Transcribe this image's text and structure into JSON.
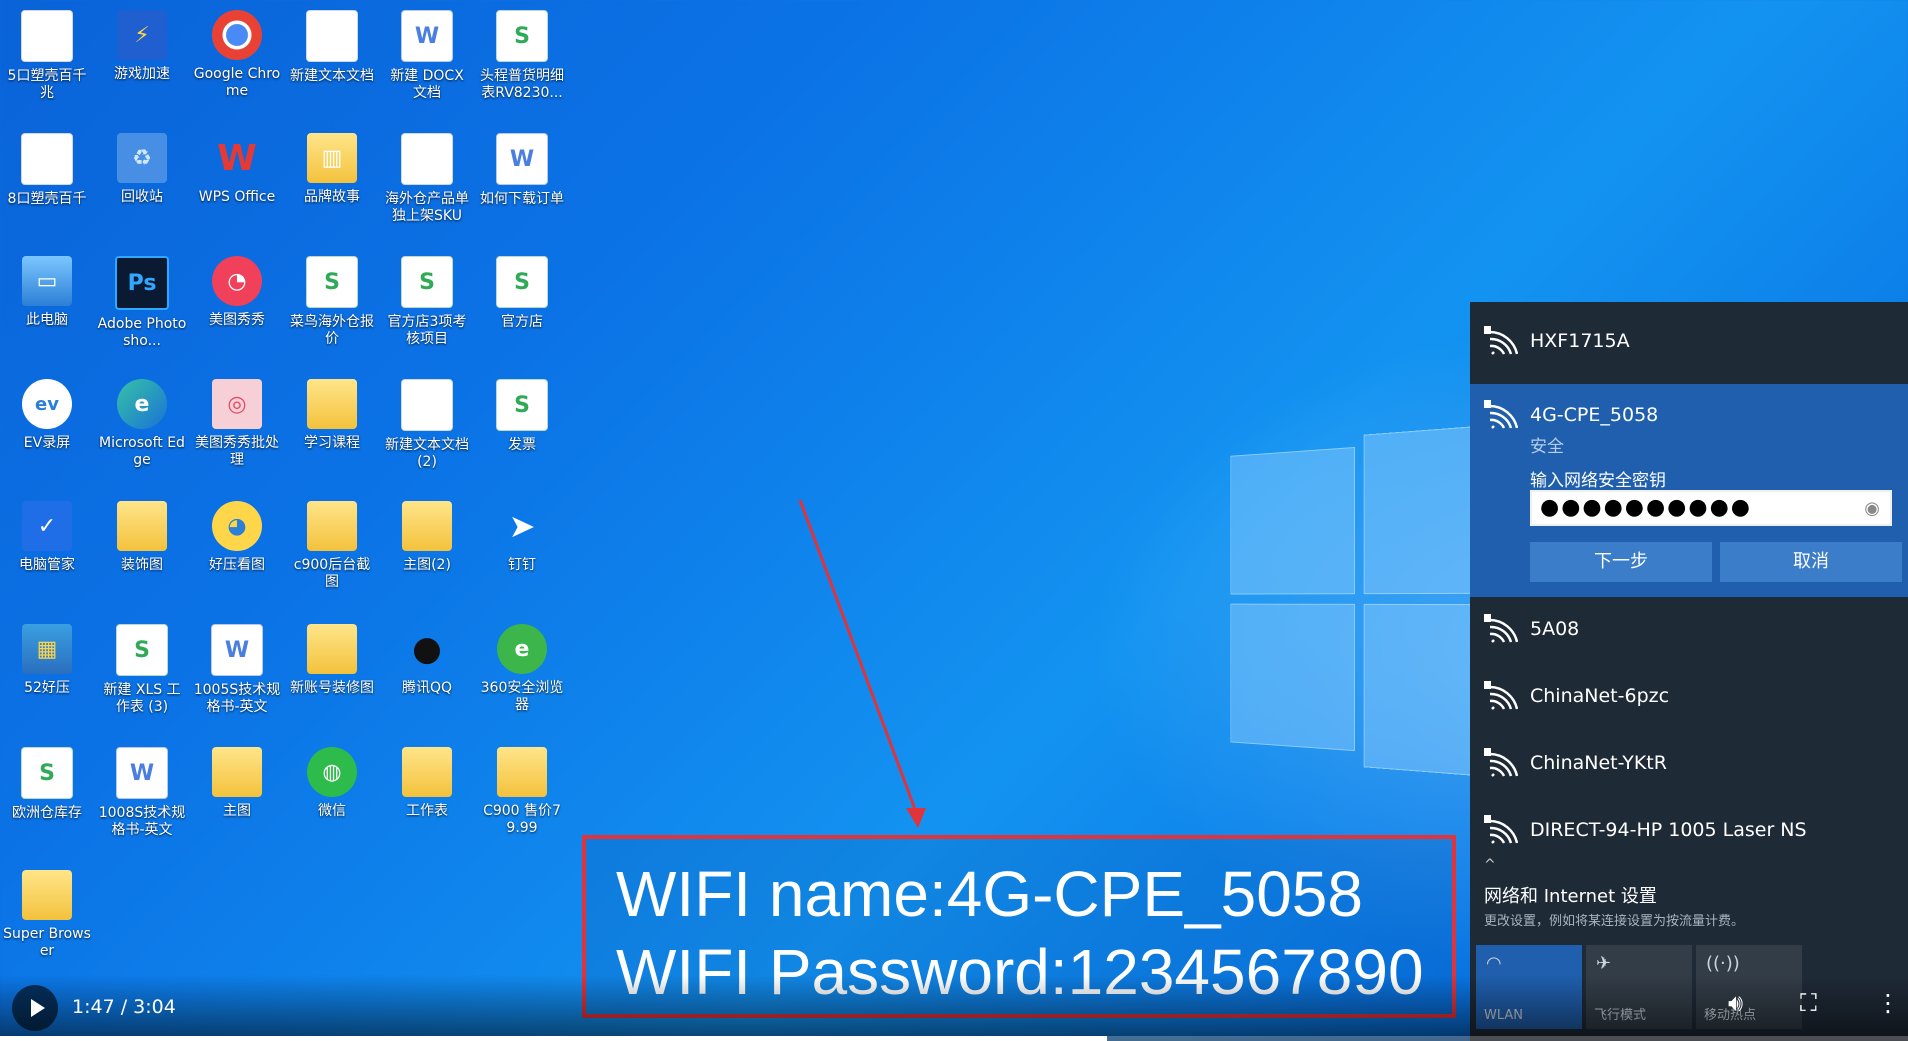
{
  "desktop": {
    "icons": [
      {
        "label": "5口塑壳百千兆",
        "glyph": "▤",
        "kind": "doc"
      },
      {
        "label": "游戏加速",
        "glyph": "⚡",
        "kind": "app"
      },
      {
        "label": "Google Chrome",
        "glyph": "◉",
        "kind": "chrome"
      },
      {
        "label": "新建文本文档",
        "glyph": "",
        "kind": "doc"
      },
      {
        "label": "新建 DOCX 文档",
        "glyph": "W",
        "kind": "wps-w"
      },
      {
        "label": "头程普货明细表RV8230...",
        "glyph": "S",
        "kind": "wps-s"
      },
      {
        "label": "8口塑壳百千",
        "glyph": "▤",
        "kind": "doc"
      },
      {
        "label": "回收站",
        "glyph": "♻",
        "kind": "recycle"
      },
      {
        "label": "WPS Office",
        "glyph": "W",
        "kind": "wps"
      },
      {
        "label": "品牌故事",
        "glyph": "▥",
        "kind": "folder"
      },
      {
        "label": "海外仓产品单独上架SKU",
        "glyph": "",
        "kind": "doc"
      },
      {
        "label": "如何下载订单",
        "glyph": "W",
        "kind": "wps-w"
      },
      {
        "label": "此电脑",
        "glyph": "▭",
        "kind": "pc"
      },
      {
        "label": "Adobe Photosho...",
        "glyph": "Ps",
        "kind": "ps"
      },
      {
        "label": "美图秀秀",
        "glyph": "◔",
        "kind": "meitu"
      },
      {
        "label": "菜鸟海外仓报价",
        "glyph": "S",
        "kind": "wps-s"
      },
      {
        "label": "官方店3项考核项目",
        "glyph": "S",
        "kind": "wps-s"
      },
      {
        "label": "官方店",
        "glyph": "S",
        "kind": "wps-s"
      },
      {
        "label": "EV录屏",
        "glyph": "ev",
        "kind": "ev"
      },
      {
        "label": "Microsoft Edge",
        "glyph": "e",
        "kind": "edge"
      },
      {
        "label": "美图秀秀批处理",
        "glyph": "◎",
        "kind": "meitu2"
      },
      {
        "label": "学习课程",
        "glyph": "",
        "kind": "folder"
      },
      {
        "label": "新建文本文档 (2)",
        "glyph": "",
        "kind": "doc"
      },
      {
        "label": "发票",
        "glyph": "S",
        "kind": "wps-s"
      },
      {
        "label": "电脑管家",
        "glyph": "✓",
        "kind": "guard"
      },
      {
        "label": "装饰图",
        "glyph": "",
        "kind": "folder"
      },
      {
        "label": "好压看图",
        "glyph": "◕",
        "kind": "viewer"
      },
      {
        "label": "c900后台截图",
        "glyph": "",
        "kind": "folder"
      },
      {
        "label": "主图(2)",
        "glyph": "",
        "kind": "folder"
      },
      {
        "label": "钉钉",
        "glyph": "➤",
        "kind": "ding"
      },
      {
        "label": "52好压",
        "glyph": "▦",
        "kind": "zip"
      },
      {
        "label": "新建 XLS 工作表 (3)",
        "glyph": "S",
        "kind": "wps-s"
      },
      {
        "label": "1005S技术规格书-英文",
        "glyph": "W",
        "kind": "wps-w"
      },
      {
        "label": "新账号装修图",
        "glyph": "",
        "kind": "folder"
      },
      {
        "label": "腾讯QQ",
        "glyph": "●",
        "kind": "qq"
      },
      {
        "label": "360安全浏览器",
        "glyph": "e",
        "kind": "360"
      },
      {
        "label": "欧洲仓库存",
        "glyph": "S",
        "kind": "wps-s"
      },
      {
        "label": "1008S技术规格书-英文",
        "glyph": "W",
        "kind": "wps-w"
      },
      {
        "label": "主图",
        "glyph": "",
        "kind": "folder"
      },
      {
        "label": "微信",
        "glyph": "◍",
        "kind": "wechat"
      },
      {
        "label": "工作表",
        "glyph": "",
        "kind": "folder"
      },
      {
        "label": "C900 售价79.99",
        "glyph": "",
        "kind": "folder"
      },
      {
        "label": "Super Browser",
        "glyph": "",
        "kind": "folder"
      }
    ]
  },
  "wifi": {
    "networks_top": [
      {
        "name": "HXF1715A"
      }
    ],
    "selected": {
      "name": "4G-CPE_5058",
      "status": "安全",
      "key_label": "输入网络安全密钥",
      "key_value": "●●●●●●●●●●",
      "next_label": "下一步",
      "cancel_label": "取消"
    },
    "networks_bottom": [
      {
        "name": "5A08"
      },
      {
        "name": "ChinaNet-6pzc"
      },
      {
        "name": "ChinaNet-YKtR"
      },
      {
        "name": "DIRECT-94-HP 1005 Laser NS"
      }
    ],
    "collapse_glyph": "^",
    "settings_title": "网络和 Internet 设置",
    "settings_sub": "更改设置，例如将某连接设置为按流量计费。",
    "quick_actions": [
      {
        "label": "WLAN",
        "icon": "wifi-icon",
        "glyph": "◠",
        "active": true
      },
      {
        "label": "飞行模式",
        "icon": "airplane-icon",
        "glyph": "✈",
        "active": false
      },
      {
        "label": "移动热点",
        "icon": "hotspot-icon",
        "glyph": "((·))",
        "active": false
      }
    ]
  },
  "caption": {
    "line1": "WIFI name:4G-CPE_5058",
    "line2": "WIFI Password:1234567890"
  },
  "player": {
    "time": "1:47 / 3:04",
    "progress": 0.58
  },
  "colors": {
    "accent": "#1f5fad",
    "caption_border": "#e1333a",
    "arrow": "#e1333a"
  }
}
